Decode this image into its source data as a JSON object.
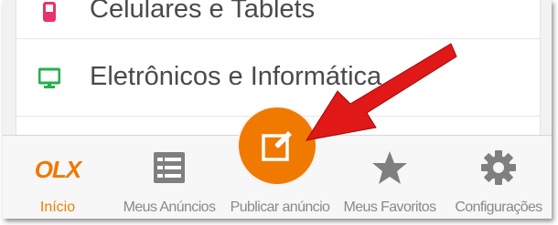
{
  "categories": [
    {
      "label": "Celulares e Tablets",
      "icon": "phone-icon",
      "color": "#e8336a"
    },
    {
      "label": "Eletrônicos e Informática",
      "icon": "monitor-icon",
      "color": "#22b14c"
    }
  ],
  "tabbar": {
    "inicio": {
      "logo": "OLX",
      "label": "Início",
      "active": true
    },
    "anuncios": {
      "label": "Meus Anúncios",
      "icon": "list-icon"
    },
    "publicar": {
      "label": "Publicar anúncio",
      "icon": "edit-icon"
    },
    "favoritos": {
      "label": "Meus Favoritos",
      "icon": "star-icon"
    },
    "config": {
      "label": "Configurações",
      "icon": "gear-icon"
    }
  },
  "colors": {
    "accent": "#f07a00",
    "arrow": "#e01818",
    "tab_inactive": "#8a8a8a",
    "icon_gray": "#7f7f7f"
  }
}
